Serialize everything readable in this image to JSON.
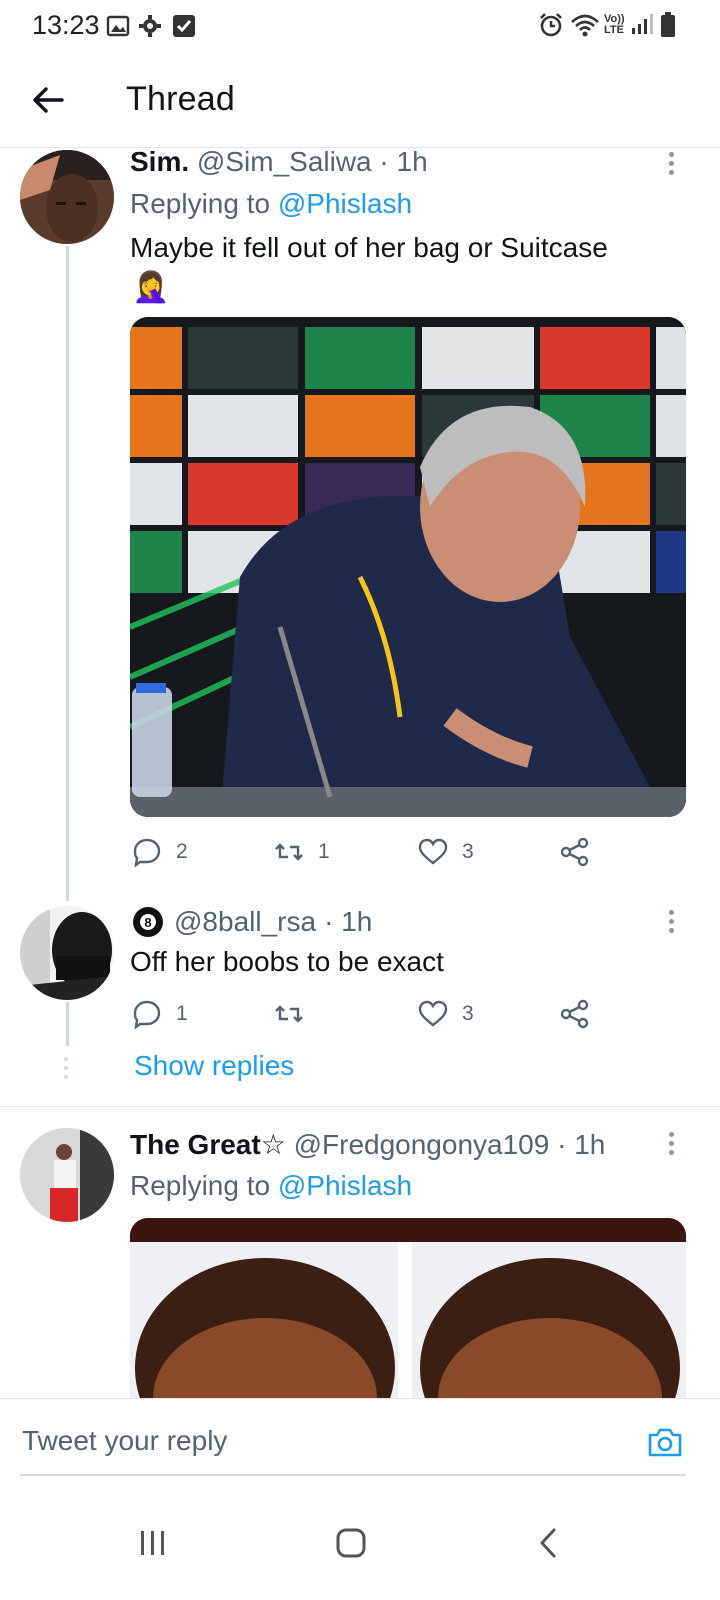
{
  "status": {
    "time": "13:23",
    "network": "Vo)) LTE"
  },
  "header": {
    "title": "Thread"
  },
  "tweets": [
    {
      "name": "Sim.",
      "handle": "@Sim_Saliwa",
      "time": "· 1h",
      "replying_label": "Replying to",
      "replying_to": "@Phislash",
      "text": "Maybe it fell out of her bag or Suitcase",
      "emoji": "🤦‍♀️",
      "replies": "2",
      "retweets": "1",
      "likes": "3"
    },
    {
      "name": "",
      "handle": "@8ball_rsa",
      "time": "· 1h",
      "text": "Off her boobs to be exact",
      "replies": "1",
      "retweets": "",
      "likes": "3"
    },
    {
      "name": "The Great☆",
      "handle": "@Fredgongonya109",
      "time": "· 1h",
      "replying_label": "Replying to",
      "replying_to": "@Phislash"
    }
  ],
  "show_replies": "Show replies",
  "reply_bar": {
    "placeholder": "Tweet your reply"
  },
  "colors": {
    "accent": "#1d9bf0",
    "secondary": "#536471"
  }
}
